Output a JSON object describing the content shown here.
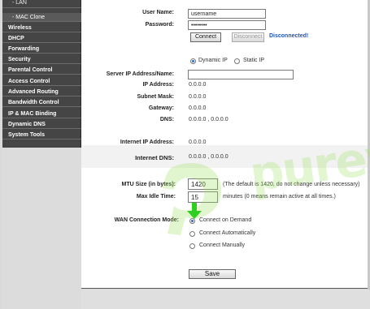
{
  "sidebar": {
    "items": [
      {
        "label": "- LAN",
        "sub": true
      },
      {
        "label": "- MAC Clone",
        "sub": true,
        "active": true
      },
      {
        "label": "Wireless"
      },
      {
        "label": "DHCP"
      },
      {
        "label": "Forwarding"
      },
      {
        "label": "Security"
      },
      {
        "label": "Parental Control"
      },
      {
        "label": "Access Control"
      },
      {
        "label": "Advanced Routing"
      },
      {
        "label": "Bandwidth Control"
      },
      {
        "label": "IP & MAC Binding"
      },
      {
        "label": "Dynamic DNS"
      },
      {
        "label": "System Tools"
      }
    ]
  },
  "account": {
    "username_label": "User Name:",
    "username_value": "username",
    "password_label": "Password:",
    "password_value": "••••••••",
    "connect_label": "Connect",
    "disconnect_label": "Disconnect",
    "status": "Disconnected!"
  },
  "ip_mode": {
    "dynamic_label": "Dynamic IP",
    "static_label": "Static IP",
    "selected": "dynamic"
  },
  "server": {
    "label": "Server IP Address/Name:",
    "value": ""
  },
  "ip_info": {
    "ip_label": "IP Address:",
    "ip_value": "0.0.0.0",
    "mask_label": "Subnet Mask:",
    "mask_value": "0.0.0.0",
    "gateway_label": "Gateway:",
    "gateway_value": "0.0.0.0",
    "dns_label": "DNS:",
    "dns_value": "0.0.0.0 , 0.0.0.0"
  },
  "internet": {
    "ip_label": "Internet IP Address:",
    "ip_value": "0.0.0.0",
    "dns_label": "Internet DNS:",
    "dns_value": "0.0.0.0 , 0.0.0.0"
  },
  "mtu": {
    "label": "MTU Size (in bytes):",
    "value": "1420",
    "note": "(The default is 1420, do not change unless necessary)"
  },
  "idle": {
    "label": "Max Idle Time:",
    "value": "15",
    "note": "minutes (0 means remain active at all times.)"
  },
  "wan_mode": {
    "label": "WAN Connection Mode:",
    "options": [
      "Connect on Demand",
      "Connect Automatically",
      "Connect Manually"
    ],
    "selected": 0
  },
  "save_label": "Save",
  "watermark": {
    "text": "purevpn"
  },
  "colors": {
    "sidebar_bg": "#454545",
    "status_blue": "#1a56c4",
    "watermark_green": "#9be15f",
    "arrow_green": "#2fcf1f"
  }
}
